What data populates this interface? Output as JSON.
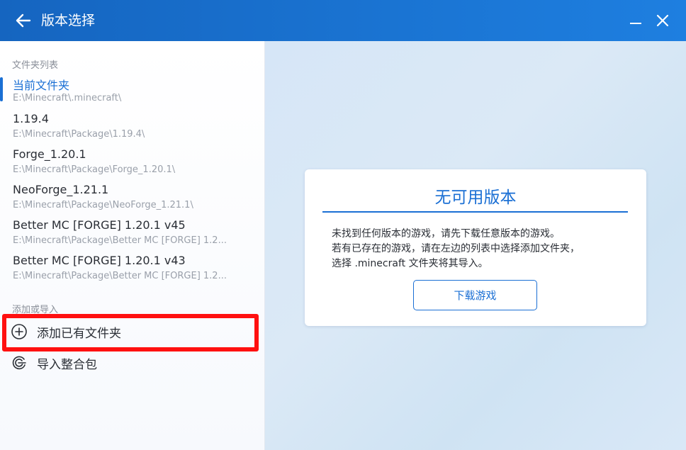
{
  "window": {
    "title": "版本选择"
  },
  "sidebar": {
    "folder_list_label": "文件夹列表",
    "folders": [
      {
        "name": "当前文件夹",
        "path": "E:\\Minecraft\\.minecraft\\"
      },
      {
        "name": "1.19.4",
        "path": "E:\\Minecraft\\Package\\1.19.4\\"
      },
      {
        "name": "Forge_1.20.1",
        "path": "E:\\Minecraft\\Package\\Forge_1.20.1\\"
      },
      {
        "name": "NeoForge_1.21.1",
        "path": "E:\\Minecraft\\Package\\NeoForge_1.21.1\\"
      },
      {
        "name": "Better MC [FORGE] 1.20.1 v45",
        "path": "E:\\Minecraft\\Package\\Better MC [FORGE] 1.2..."
      },
      {
        "name": "Better MC [FORGE] 1.20.1 v43",
        "path": "E:\\Minecraft\\Package\\Better MC [FORGE] 1.2..."
      }
    ],
    "add_import_label": "添加或导入",
    "actions": [
      {
        "label": "添加已有文件夹",
        "icon": "plus-circle-icon"
      },
      {
        "label": "导入整合包",
        "icon": "import-pack-icon"
      }
    ]
  },
  "main": {
    "card": {
      "title": "无可用版本",
      "lines": [
        "未找到任何版本的游戏，请先下载任意版本的游戏。",
        "若有已存在的游戏，请在左边的列表中选择添加文件夹，",
        "选择 .minecraft 文件夹将其导入。"
      ],
      "button_label": "下载游戏"
    }
  },
  "colors": {
    "accent": "#1a6fd4",
    "titlebar": "#1565c0",
    "highlight": "#ff1010"
  }
}
